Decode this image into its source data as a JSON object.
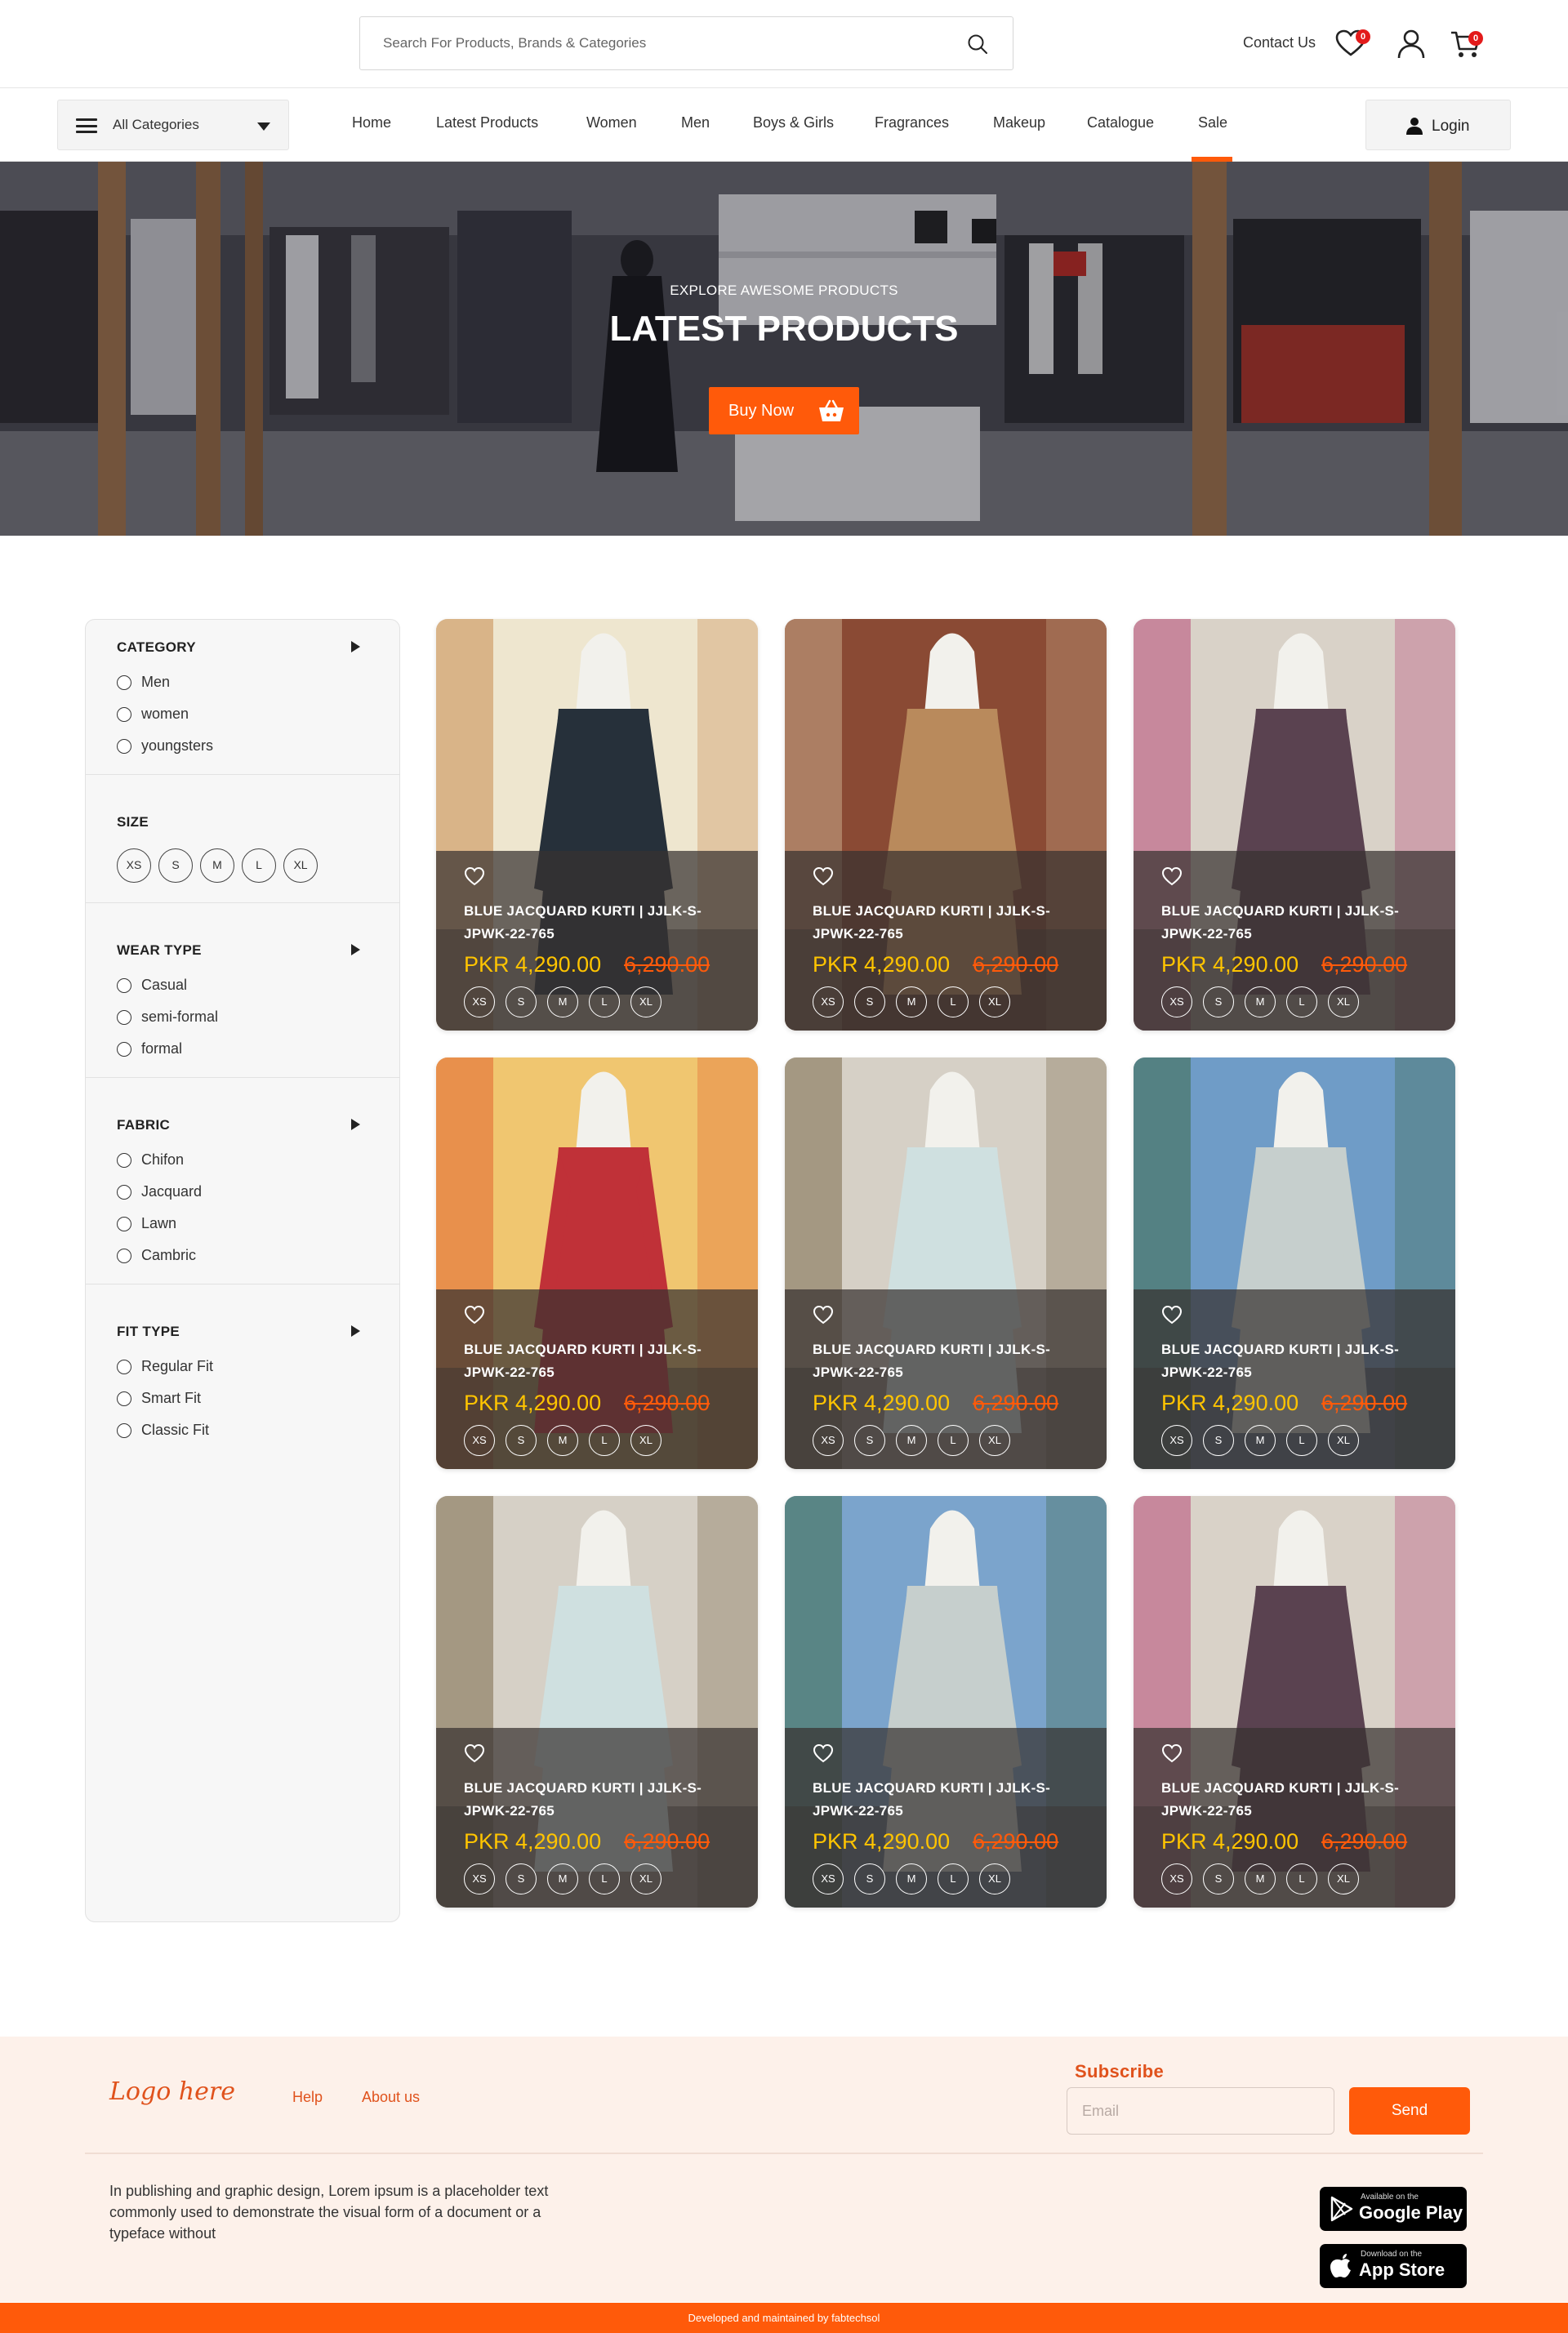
{
  "header": {
    "search_placeholder": "Search For Products, Brands & Categories",
    "contact_label": "Contact Us",
    "wishlist_count": "0",
    "cart_count": "0",
    "icons": [
      "search-icon",
      "heart-icon",
      "user-icon",
      "cart-icon"
    ]
  },
  "nav": {
    "all_categories_label": "All Categories",
    "items": [
      "Home",
      "Latest Products",
      "Women",
      "Men",
      "Boys & Girls",
      "Fragrances",
      "Makeup",
      "Catalogue",
      "Sale"
    ],
    "active_item": "Sale",
    "login_label": "Login"
  },
  "hero": {
    "eyebrow": "EXPLORE AWESOME PRODUCTS",
    "title": "LATEST PRODUCTS",
    "cta_label": "Buy Now"
  },
  "filters": {
    "category": {
      "title": "CATEGORY",
      "options": [
        "Men",
        "women",
        "youngsters"
      ]
    },
    "size": {
      "title": "SIZE",
      "options": [
        "XS",
        "S",
        "M",
        "L",
        "XL"
      ]
    },
    "wear_type": {
      "title": "WEAR TYPE",
      "options": [
        "Casual",
        "semi-formal",
        "formal"
      ]
    },
    "fabric": {
      "title": "FABRIC",
      "options": [
        "Chifon",
        "Jacquard",
        "Lawn",
        "Cambric"
      ]
    },
    "fit_type": {
      "title": "FIT TYPE",
      "options": [
        "Regular Fit",
        "Smart Fit",
        "Classic Fit"
      ]
    }
  },
  "products": [
    {
      "name": "BLUE JACQUARD KURTI | JJLK-S-JPWK-22-765",
      "price": "PKR 4,290.00",
      "old_price": "6,290.00",
      "sizes": [
        "XS",
        "S",
        "M",
        "L",
        "XL"
      ]
    },
    {
      "name": "BLUE JACQUARD KURTI | JJLK-S-JPWK-22-765",
      "price": "PKR 4,290.00",
      "old_price": "6,290.00",
      "sizes": [
        "XS",
        "S",
        "M",
        "L",
        "XL"
      ]
    },
    {
      "name": "BLUE JACQUARD KURTI | JJLK-S-JPWK-22-765",
      "price": "PKR 4,290.00",
      "old_price": "6,290.00",
      "sizes": [
        "XS",
        "S",
        "M",
        "L",
        "XL"
      ]
    },
    {
      "name": "BLUE JACQUARD KURTI | JJLK-S-JPWK-22-765",
      "price": "PKR 4,290.00",
      "old_price": "6,290.00",
      "sizes": [
        "XS",
        "S",
        "M",
        "L",
        "XL"
      ]
    },
    {
      "name": "BLUE JACQUARD KURTI | JJLK-S-JPWK-22-765",
      "price": "PKR 4,290.00",
      "old_price": "6,290.00",
      "sizes": [
        "XS",
        "S",
        "M",
        "L",
        "XL"
      ]
    },
    {
      "name": "BLUE JACQUARD KURTI | JJLK-S-JPWK-22-765",
      "price": "PKR 4,290.00",
      "old_price": "6,290.00",
      "sizes": [
        "XS",
        "S",
        "M",
        "L",
        "XL"
      ]
    },
    {
      "name": "BLUE JACQUARD KURTI | JJLK-S-JPWK-22-765",
      "price": "PKR 4,290.00",
      "old_price": "6,290.00",
      "sizes": [
        "XS",
        "S",
        "M",
        "L",
        "XL"
      ]
    },
    {
      "name": "BLUE JACQUARD KURTI | JJLK-S-JPWK-22-765",
      "price": "PKR 4,290.00",
      "old_price": "6,290.00",
      "sizes": [
        "XS",
        "S",
        "M",
        "L",
        "XL"
      ]
    },
    {
      "name": "BLUE JACQUARD KURTI | JJLK-S-JPWK-22-765",
      "price": "PKR 4,290.00",
      "old_price": "6,290.00",
      "sizes": [
        "XS",
        "S",
        "M",
        "L",
        "XL"
      ]
    }
  ],
  "footer": {
    "logo_text": "Logo here",
    "links": [
      "Help",
      "About us"
    ],
    "subscribe_title": "Subscribe",
    "email_placeholder": "Email",
    "send_label": "Send",
    "description": "In publishing and graphic design, Lorem ipsum is a placeholder text commonly used to demonstrate the visual form of a document or a typeface without",
    "google_play_small": "Available on the",
    "google_play_big": "Google Play",
    "app_store_small": "Download on the",
    "app_store_big": "App Store",
    "credit": "Developed and maintained by fabtechsol"
  },
  "colors": {
    "accent": "#ff5a0a",
    "price": "#ffc400",
    "badge": "#e31b1b",
    "footer_bg": "#fdf1ea"
  }
}
